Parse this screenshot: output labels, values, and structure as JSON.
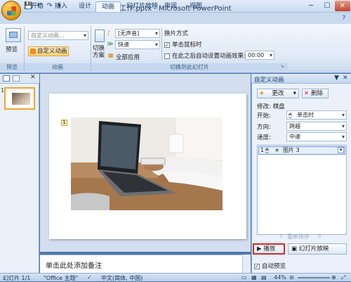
{
  "window": {
    "title": "工作.pptx - Microsoft PowerPoint",
    "minimize": "─",
    "maximize": "☐",
    "close": "✕"
  },
  "qat": {
    "save": "💾",
    "undo": "↶",
    "redo": "↷",
    "more": "▾"
  },
  "tabs": [
    "开始",
    "插入",
    "设计",
    "动画",
    "幻灯片放映",
    "审阅",
    "视图"
  ],
  "active_tab": "动画",
  "ribbon": {
    "preview": {
      "label": "预览",
      "group": "预览"
    },
    "animation": {
      "combo": "自定义动画…",
      "custom_button": "自定义动画",
      "group": "动画"
    },
    "transition": {
      "switch_label": "切换\n方案",
      "sound_combo": "[无声音]",
      "speed_combo": "快速",
      "apply_all": "全部应用",
      "section_title": "换片方式",
      "on_click_label": "单击鼠标时",
      "on_click_checked": true,
      "auto_label": "在此之后自动设置动画效果:",
      "auto_checked": false,
      "auto_time": "00:00",
      "group": "切换到此幻灯片"
    }
  },
  "slides_pane": {
    "slide_number": "1"
  },
  "slide": {
    "anim_marker": "1"
  },
  "notes_placeholder": "单击此处添加备注",
  "anim_pane": {
    "title": "自定义动画",
    "change_button": "更改",
    "delete_button": "删除",
    "modify_label": "修改: 棋盘",
    "start_label": "开始:",
    "start_value": "单击时",
    "direction_label": "方向:",
    "direction_value": "跨越",
    "speed_label": "速度:",
    "speed_value": "中速",
    "item_number": "1",
    "item_name": "图片 3",
    "reorder_label": "重新排序",
    "play_button": "播放",
    "slideshow_button": "幻灯片放映",
    "autopreview_label": "自动预览",
    "autopreview_checked": true
  },
  "status": {
    "slide": "幻灯片 1/1",
    "theme": "\"Office 主题\"",
    "language": "中文(简体, 中国)",
    "zoom": "44%"
  }
}
